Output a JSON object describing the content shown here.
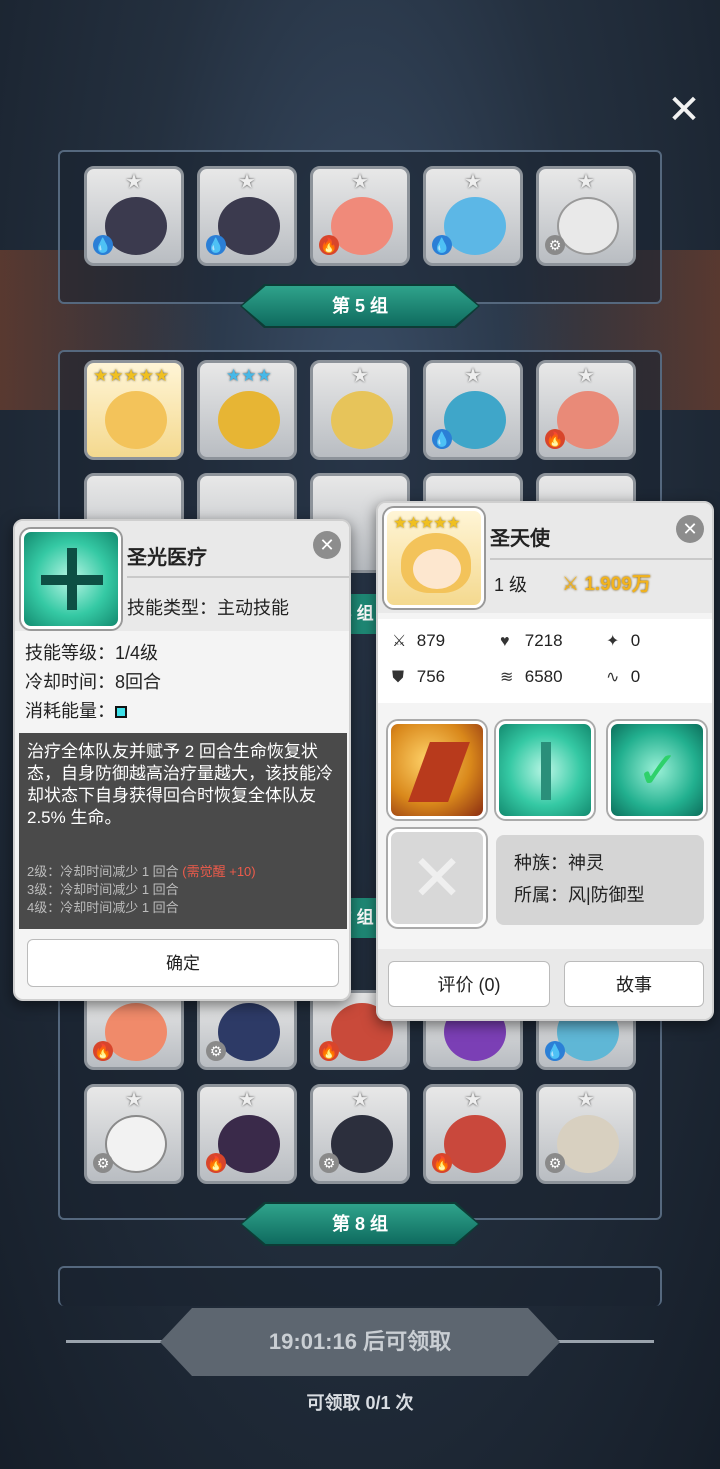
{
  "screen": {
    "close_icon": "close-icon",
    "groups": [
      {
        "label": "第 5 组"
      },
      {
        "label": "第 8 组"
      }
    ],
    "partial_group_labels": [
      "6 组",
      "7 组"
    ],
    "timer_text": "19:01:16 后可领取",
    "claim_text": "可领取 0/1 次"
  },
  "skill_popup": {
    "name": "圣光医疗",
    "type_line": "技能类型：主动技能",
    "level_line": "技能等级：1/4级",
    "cooldown_line": "冷却时间：8回合",
    "energy_label": "消耗能量：",
    "description": "治疗全体队友并赋予 2 回合生命恢复状态，自身防御越高治疗量越大，该技能冷却状态下自身获得回合时恢复全体队友 2.5% 生命。",
    "upgrades": [
      {
        "text": "2级：冷却时间减少 1 回合 ",
        "note": "(需觉醒 +10)"
      },
      {
        "text": "3级：冷却时间减少 1 回合",
        "note": ""
      },
      {
        "text": "4级：冷却时间减少 1 回合",
        "note": ""
      }
    ],
    "confirm_label": "确定"
  },
  "hero_popup": {
    "name": "圣天使",
    "level": "1 级",
    "power": "1.909万",
    "stars": "★★★★★",
    "stats": [
      {
        "icon": "sword-icon",
        "value": "879"
      },
      {
        "icon": "heart-icon",
        "value": "7218"
      },
      {
        "icon": "crit-icon",
        "value": "0"
      },
      {
        "icon": "shield-icon",
        "value": "756"
      },
      {
        "icon": "speed-icon",
        "value": "6580"
      },
      {
        "icon": "dodge-icon",
        "value": "0"
      }
    ],
    "race_line": "种族：神灵",
    "faction_line": "所属：风|防御型",
    "review_label": "评价 (0)",
    "story_label": "故事"
  },
  "colors": {
    "banner": "#1f8a76",
    "power": "#f2b31d",
    "upgrade_note": "#ee5b4b"
  }
}
